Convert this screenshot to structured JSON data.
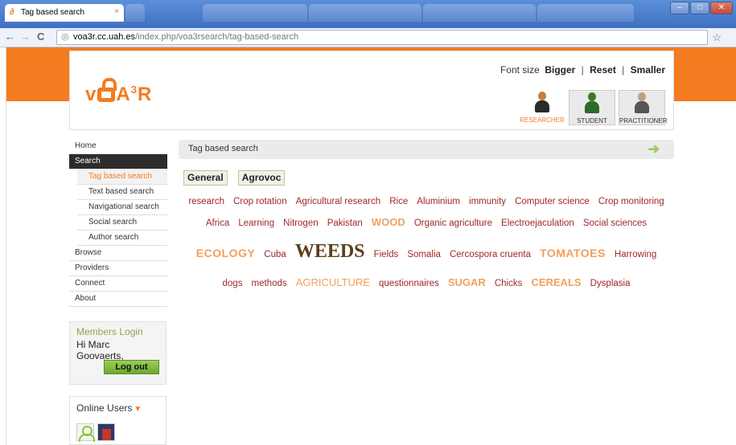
{
  "browser": {
    "tabs": [
      {
        "label": "Tag based search",
        "active": true
      },
      {
        "label": "",
        "active": false
      },
      {
        "label": "",
        "active": false
      },
      {
        "label": "",
        "active": false
      },
      {
        "label": "",
        "active": false
      },
      {
        "label": "",
        "active": false
      }
    ],
    "url_host": "voa3r.cc.uah.es",
    "url_path": "/index.php/voa3rsearch/tag-based-search"
  },
  "header": {
    "logo_text": "VOA3R",
    "font_size_label": "Font size",
    "font_bigger": "Bigger",
    "font_reset": "Reset",
    "font_smaller": "Smaller",
    "roles": [
      {
        "label": "RESEARCHER",
        "selected": true
      },
      {
        "label": "STUDENT",
        "selected": false
      },
      {
        "label": "PRACTITIONER",
        "selected": false
      }
    ]
  },
  "sidebar": {
    "items": [
      {
        "label": "Home"
      },
      {
        "label": "Search",
        "active": true
      },
      {
        "label": "Tag based search",
        "sub": true,
        "current": true
      },
      {
        "label": "Text based search",
        "sub": true
      },
      {
        "label": "Navigational search",
        "sub": true
      },
      {
        "label": "Social search",
        "sub": true
      },
      {
        "label": "Author search",
        "sub": true
      },
      {
        "label": "Browse"
      },
      {
        "label": "Providers"
      },
      {
        "label": "Connect"
      },
      {
        "label": "About"
      }
    ],
    "login": {
      "title": "Members Login",
      "greeting": "Hi Marc Goovaerts,",
      "logout": "Log out"
    },
    "online": {
      "title": "Online Users"
    }
  },
  "main": {
    "title": "Tag based search",
    "vocab_tabs": [
      "General",
      "Agrovoc"
    ],
    "tag_lines": [
      [
        "research",
        "Crop rotation",
        "Agricultural research",
        "Rice",
        "Aluminium",
        "immunity",
        "Computer science",
        "Crop monitoring"
      ],
      [
        "Africa",
        "Learning",
        "Nitrogen",
        "Pakistan",
        "WOOD",
        "Organic agriculture",
        "Electroejaculation",
        "Social sciences"
      ],
      [
        "ECOLOGY",
        "Cuba",
        "WEEDS",
        "Fields",
        "Somalia",
        "Cercospora cruenta",
        "TOMATOES",
        "Harrowing"
      ],
      [
        "dogs",
        "methods",
        "AGRICULTURE",
        "questionnaires",
        "SUGAR",
        "Chicks",
        "CEREALS",
        "Dysplasia"
      ]
    ]
  },
  "colors": {
    "brand_orange": "#f47b20",
    "tag_red": "#a0282a",
    "tag_highlight": "#f0a060",
    "tag_dark": "#5b3f1c"
  }
}
